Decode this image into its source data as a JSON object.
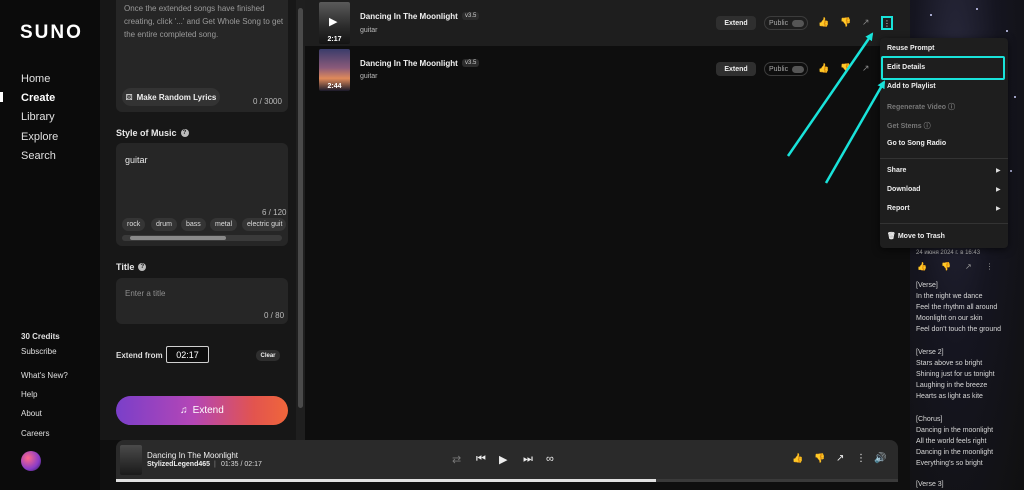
{
  "brand": {
    "logo": "SUNO"
  },
  "nav": {
    "home": "Home",
    "create": "Create",
    "library": "Library",
    "explore": "Explore",
    "search": "Search"
  },
  "sidebar_footer": {
    "credits": "30 Credits",
    "subscribe": "Subscribe",
    "whats_new": "What's New?",
    "help": "Help",
    "about": "About",
    "careers": "Careers"
  },
  "create": {
    "lyrics_hint": "Once the extended songs have finished creating, click '...' and Get Whole Song to get the entire completed song.",
    "random_lyrics_label": "Make Random Lyrics",
    "lyrics_count": "0 / 3000",
    "style_label": "Style of Music",
    "style_value": "guitar",
    "style_count": "6 / 120",
    "style_chips": [
      "rock",
      "drum",
      "bass",
      "metal",
      "electric guit"
    ],
    "title_label": "Title",
    "title_placeholder": "Enter a title",
    "title_count": "0 / 80",
    "extend_from_label": "Extend from",
    "extend_from_value": "02:17",
    "clear_label": "Clear",
    "extend_button": "Extend"
  },
  "songs": [
    {
      "title": "Dancing In The Moonlight",
      "version": "v3.5",
      "style": "guitar",
      "duration": "2:17",
      "extend_label": "Extend",
      "public_label": "Public"
    },
    {
      "title": "Dancing In The Moonlight",
      "version": "v3.5",
      "style": "guitar",
      "duration": "2:44",
      "extend_label": "Extend",
      "public_label": "Public"
    }
  ],
  "context_menu": {
    "reuse_prompt": "Reuse Prompt",
    "edit_details": "Edit Details",
    "add_to_playlist": "Add to Playlist",
    "regenerate_video": "Regenerate Video",
    "get_stems": "Get Stems",
    "go_to_song_radio": "Go to Song Radio",
    "share": "Share",
    "download": "Download",
    "report": "Report",
    "move_to_trash": "Move to Trash"
  },
  "right_panel": {
    "date": "24 июня 2024 г. в 16:43",
    "lyrics": [
      "[Verse]",
      "In the night we dance",
      "Feel the rhythm all around",
      "Moonlight on our skin",
      "Feel don't touch the ground",
      "",
      "[Verse 2]",
      "Stars above so bright",
      "Shining just for us tonight",
      "Laughing in the breeze",
      "Hearts as light as kite",
      "",
      "[Chorus]",
      "Dancing in the moonlight",
      "All the world feels right",
      "Dancing in the moonlight",
      "Everything's so bright",
      "",
      "[Verse 3]"
    ]
  },
  "player": {
    "title": "Dancing In The Moonlight",
    "artist": "StylizedLegend465",
    "separator": "|",
    "time": "01:35 / 02:17",
    "progress": 0.69
  },
  "colors": {
    "accent_annotation": "#19e3da",
    "extend_gradient_start": "#7a3fc9",
    "extend_gradient_end": "#f0663a"
  }
}
